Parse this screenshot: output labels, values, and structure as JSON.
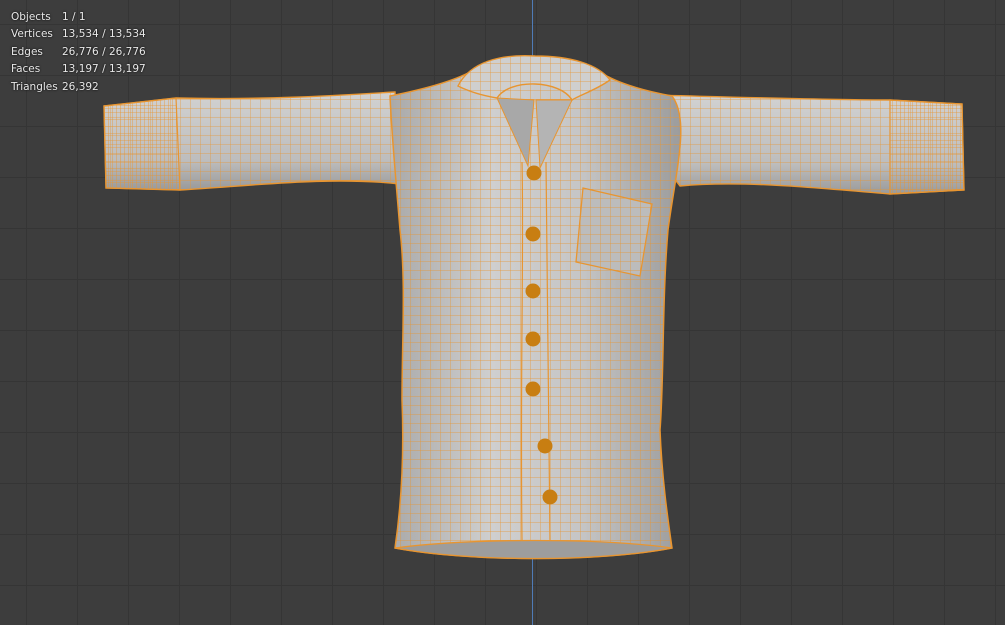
{
  "stats": [
    {
      "label": "Objects",
      "value": "1 / 1"
    },
    {
      "label": "Vertices",
      "value": "13,534 / 13,534"
    },
    {
      "label": "Edges",
      "value": "26,776 / 26,776"
    },
    {
      "label": "Faces",
      "value": "13,197 / 13,197"
    },
    {
      "label": "Triangles",
      "value": "26,392"
    }
  ],
  "colors": {
    "background": "#3d3d3d",
    "grid": "#353535",
    "y_axis": "#4f7bb6",
    "mesh_fill": "#bdbdbd",
    "wire": "#e89530",
    "button": "#c87e12"
  }
}
